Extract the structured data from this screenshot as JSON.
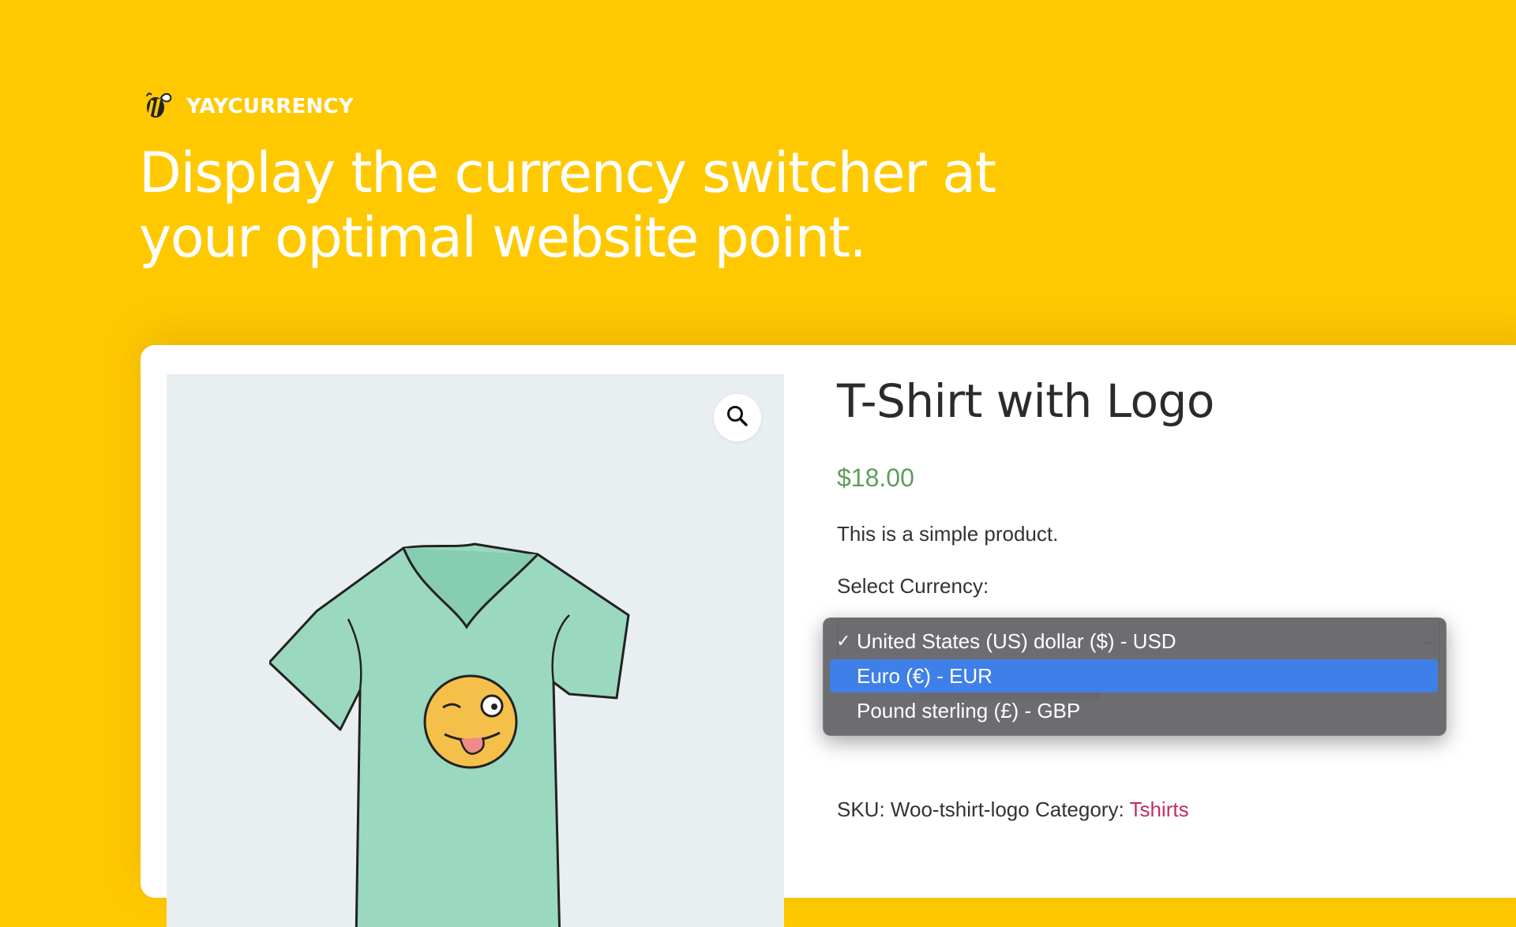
{
  "brand": {
    "name": "YAYCURRENCY",
    "logo_icon": "bee-icon"
  },
  "headline": {
    "line1": "Display the currency switcher at",
    "line2": "your optimal website point."
  },
  "product": {
    "title": "T-Shirt with Logo",
    "price": "$18.00",
    "description": "This is a simple product.",
    "select_label": "Select Currency:",
    "sku_label": "SKU:",
    "sku_value": "Woo-tshirt-logo",
    "category_label": "Category:",
    "category_value": "Tshirts"
  },
  "currency_dropdown": {
    "options": [
      {
        "label": "United States (US) dollar ($) - USD",
        "checked": true
      },
      {
        "label": "Euro (€) - EUR",
        "highlighted": true
      },
      {
        "label": "Pound sterling (£) - GBP"
      }
    ],
    "checkmark": "✓"
  },
  "colors": {
    "background": "#FFC902",
    "price": "#5E9E5A",
    "highlight": "#3F80E8",
    "category_link": "#C22E5E",
    "cart_button": "#A45A95"
  }
}
